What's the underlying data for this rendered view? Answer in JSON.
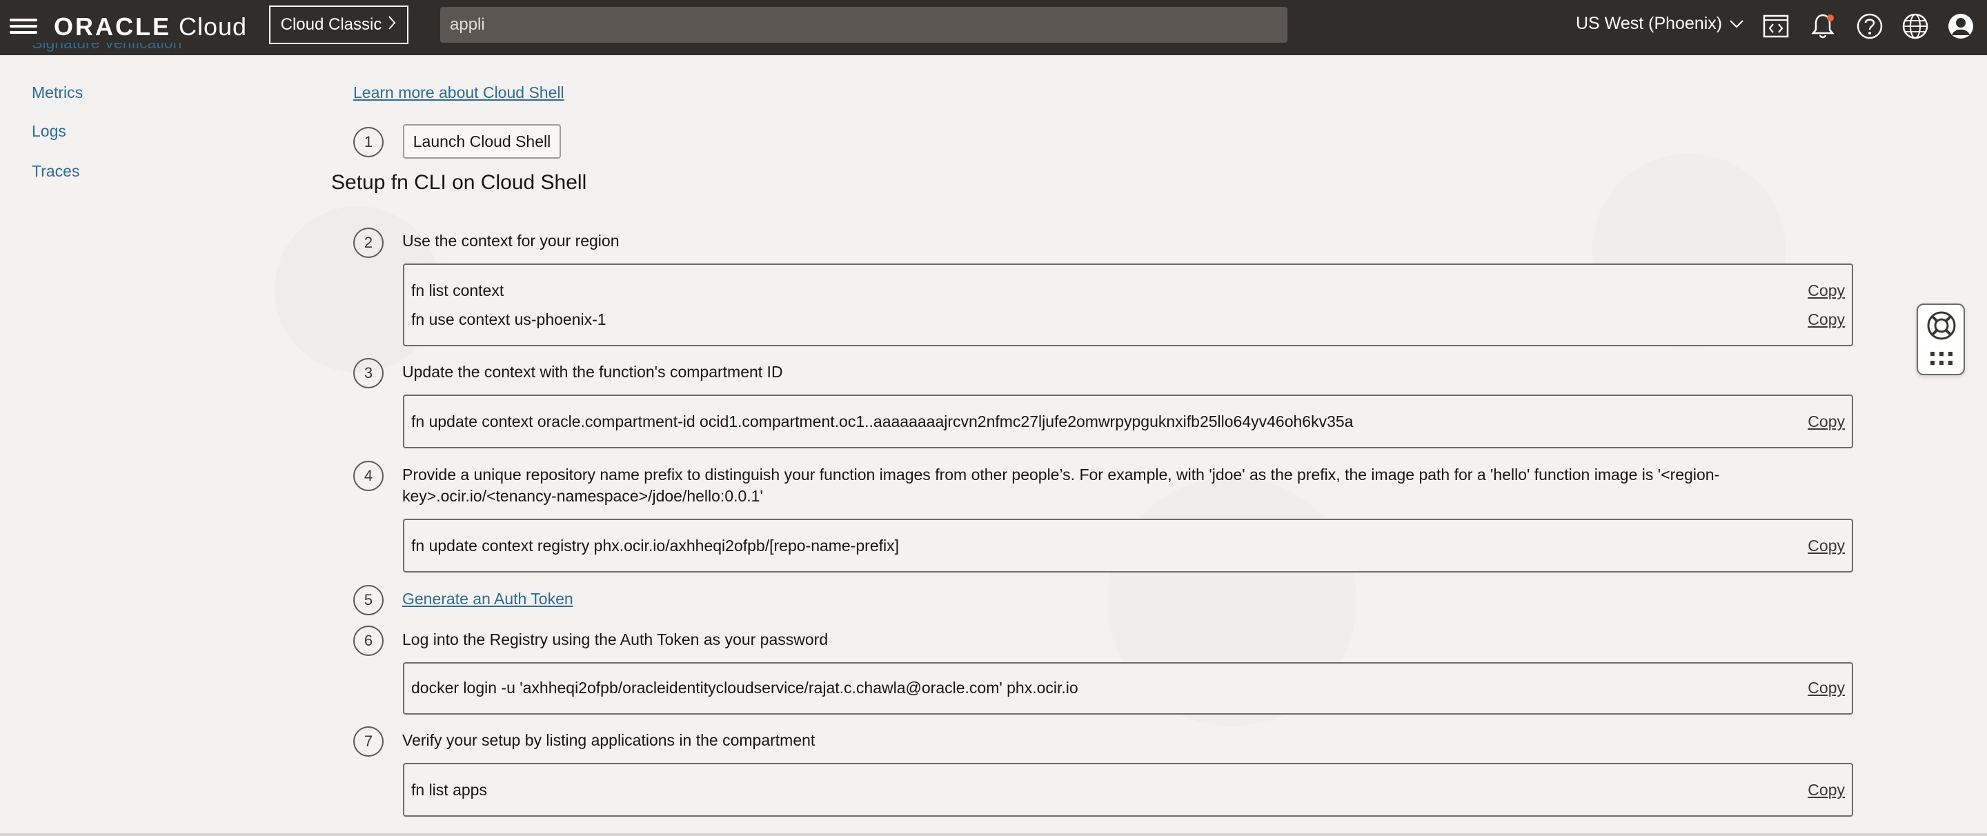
{
  "header": {
    "brand": "ORACLE",
    "brand_suffix": "Cloud",
    "classic_button": "Cloud Classic",
    "search_value": "appli",
    "region": "US West (Phoenix)"
  },
  "sidebar": {
    "cut_item": "Signature Verification",
    "items": [
      {
        "label": "Metrics"
      },
      {
        "label": "Logs"
      },
      {
        "label": "Traces"
      }
    ]
  },
  "content": {
    "learn_more": "Learn more about Cloud Shell",
    "launch_button": "Launch Cloud Shell",
    "section_title": "Setup fn CLI on Cloud Shell",
    "copy_label": "Copy",
    "steps": [
      {
        "num": "1"
      },
      {
        "num": "2",
        "text": "Use the context for your region",
        "code": [
          "fn list context",
          "fn use context us-phoenix-1"
        ]
      },
      {
        "num": "3",
        "text": "Update the context with the function's compartment ID",
        "code": [
          "fn update context oracle.compartment-id ocid1.compartment.oc1..aaaaaaaajrcvn2nfmc27ljufe2omwrpypguknxifb25llo64yv46oh6kv35a"
        ]
      },
      {
        "num": "4",
        "text_line1": "Provide a unique repository name prefix to distinguish your function images from other people’s. For example, with 'jdoe' as the prefix, the image path for a 'hello' function image is '<region-",
        "text_line2": "key>.ocir.io/<tenancy-namespace>/jdoe/hello:0.0.1'",
        "code": [
          "fn update context registry phx.ocir.io/axhheqi2ofpb/[repo-name-prefix]"
        ]
      },
      {
        "num": "5",
        "link": "Generate an Auth Token"
      },
      {
        "num": "6",
        "text": "Log into the Registry using the Auth Token as your password",
        "code": [
          "docker login -u 'axhheqi2ofpb/oracleidentitycloudservice/rajat.c.chawla@oracle.com' phx.ocir.io"
        ]
      },
      {
        "num": "7",
        "text": "Verify your setup by listing applications in the compartment",
        "code": [
          "fn list apps"
        ]
      }
    ]
  },
  "colors": {
    "header_bg": "#312d2a",
    "link": "#2f6b96",
    "page_bg": "#f3f2f0"
  }
}
